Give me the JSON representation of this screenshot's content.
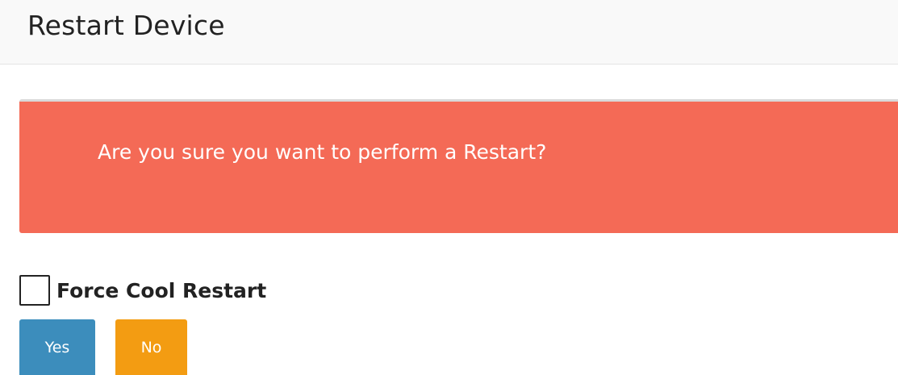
{
  "header": {
    "title": "Restart Device"
  },
  "alert": {
    "message": "Are you sure you want to perform a Restart?",
    "background_color": "#f46a56"
  },
  "options": {
    "force_cool_restart": {
      "label": "Force Cool Restart",
      "checked": false
    }
  },
  "buttons": {
    "yes_label": "Yes",
    "no_label": "No",
    "yes_color": "#3c8dbc",
    "no_color": "#f39c12"
  }
}
